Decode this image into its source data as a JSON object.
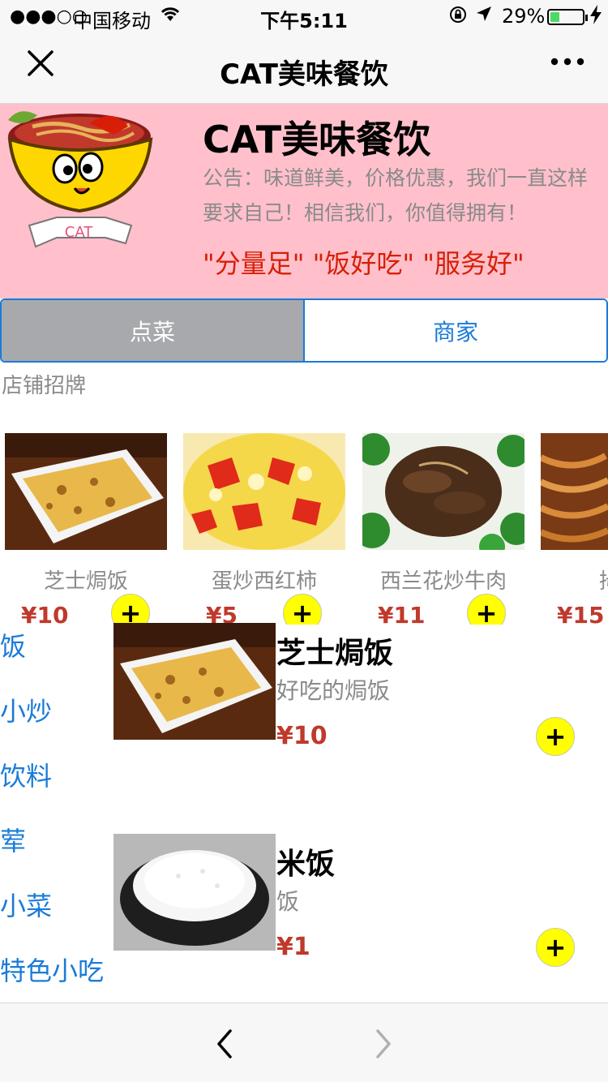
{
  "status": {
    "carrier": "中国移动",
    "time": "下午5:11",
    "battery": "29%",
    "battery_level": 0.29
  },
  "nav": {
    "title": "CAT美味餐饮"
  },
  "shop": {
    "name": "CAT美味餐饮",
    "notice": "公告：味道鲜美，价格优惠，我们一直这样要求自己！相信我们，你值得拥有！",
    "slogan": "\"分量足\" \"饭好吃\" \"服务好\"",
    "logo_text": "CAT"
  },
  "tabs": [
    {
      "label": "点菜"
    },
    {
      "label": "商家"
    }
  ],
  "featured": {
    "title": "店铺招牌",
    "items": [
      {
        "name": "芝士焗饭",
        "price": "¥10"
      },
      {
        "name": "蛋炒西红柿",
        "price": "¥5"
      },
      {
        "name": "西兰花炒牛肉",
        "price": "¥11"
      },
      {
        "name": "拇",
        "price": "¥15"
      }
    ],
    "add_label": "+"
  },
  "categories": [
    "饭",
    "小炒",
    "饮料",
    "荤",
    "小菜",
    "特色小吃"
  ],
  "menu": [
    {
      "name": "芝士焗饭",
      "desc": "好吃的焗饭",
      "price": "¥10"
    },
    {
      "name": "米饭",
      "desc": "饭",
      "price": "¥1"
    }
  ],
  "colors": {
    "banner": "#ffc0cb",
    "accent": "#1a7bd8",
    "price": "#c0392b",
    "add_button": "#ffff00"
  }
}
